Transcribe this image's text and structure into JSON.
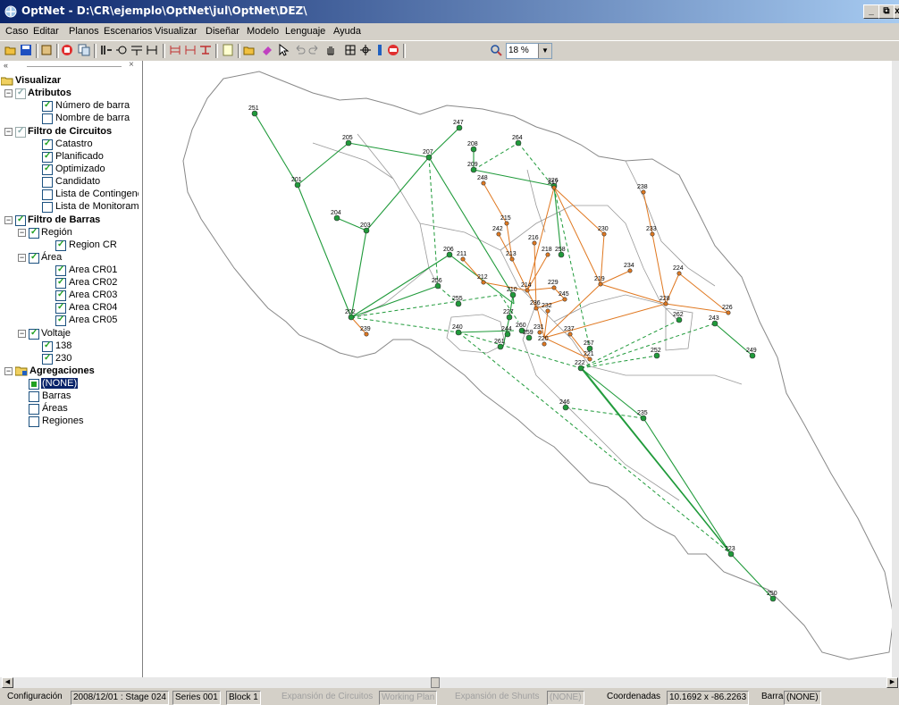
{
  "window": {
    "title": "OptNet - D:\\CR\\ejemplo\\OptNet\\jul\\OptNet\\DEZ\\"
  },
  "menu": [
    "Caso",
    "Editar",
    "Planos",
    "Escenarios",
    "Visualizar",
    "Diseñar",
    "Modelo",
    "Lenguaje",
    "Ayuda"
  ],
  "toolbar": {
    "zoom_value": "18 %"
  },
  "tree": {
    "root": "Visualizar",
    "atributos": "Atributos",
    "numero_barra": "Número de barra",
    "nombre_barra": "Nombre de barra",
    "filtro_circuitos": "Filtro de Circuitos",
    "catastro": "Catastro",
    "planificado": "Planificado",
    "optimizado": "Optimizado",
    "candidato": "Candidato",
    "lista_contingencias": "Lista de Contingenc",
    "lista_monitoreo": "Lista de Monitorami",
    "filtro_barras": "Filtro de Barras",
    "region": "Región",
    "region_cr": "Region CR",
    "area": "Área",
    "areas": [
      "Area CR01",
      "Area CR02",
      "Area CR03",
      "Area CR04",
      "Area CR05"
    ],
    "voltaje": "Voltaje",
    "v138": "138",
    "v230": "230",
    "agregaciones": "Agregaciones",
    "none": "(NONE)",
    "barras": "Barras",
    "areas_agg": "Áreas",
    "regiones": "Regiones"
  },
  "status": {
    "configuracion": "Configuración",
    "fecha_stage": "2008/12/01 : Stage 024",
    "series": "Series 001",
    "block": "Block 1",
    "exp_circuitos": "Expansión de Circuitos",
    "working_plan": "Working Plan",
    "exp_shunts": "Expansión de Shunts",
    "shunts_val": "(NONE)",
    "coordenadas_lbl": "Coordenadas",
    "coordenadas_val": "10.1692 x -86.2263",
    "barra_lbl": "Barra",
    "barra_val": "(NONE)"
  },
  "map": {
    "colors": {
      "green": "#1f9a3a",
      "orange": "#e07820",
      "border": "#808080"
    },
    "buses": [
      {
        "id": "251",
        "c": "g"
      },
      {
        "id": "205",
        "c": "g"
      },
      {
        "id": "207",
        "c": "g"
      },
      {
        "id": "247",
        "c": "g"
      },
      {
        "id": "208",
        "c": "g"
      },
      {
        "id": "264",
        "c": "g"
      },
      {
        "id": "209",
        "c": "g"
      },
      {
        "id": "201",
        "c": "g"
      },
      {
        "id": "248",
        "c": "o"
      },
      {
        "id": "226",
        "c": "g"
      },
      {
        "id": "217",
        "c": "o"
      },
      {
        "id": "238",
        "c": "o"
      },
      {
        "id": "204",
        "c": "g"
      },
      {
        "id": "203",
        "c": "g"
      },
      {
        "id": "215",
        "c": "o"
      },
      {
        "id": "242",
        "c": "o"
      },
      {
        "id": "230",
        "c": "o"
      },
      {
        "id": "233",
        "c": "o"
      },
      {
        "id": "216",
        "c": "o"
      },
      {
        "id": "206",
        "c": "g"
      },
      {
        "id": "211",
        "c": "o"
      },
      {
        "id": "213",
        "c": "o"
      },
      {
        "id": "218",
        "c": "o"
      },
      {
        "id": "258",
        "c": "g"
      },
      {
        "id": "234",
        "c": "o"
      },
      {
        "id": "224",
        "c": "o"
      },
      {
        "id": "212",
        "c": "o"
      },
      {
        "id": "256",
        "c": "g"
      },
      {
        "id": "210",
        "c": "g"
      },
      {
        "id": "214",
        "c": "o"
      },
      {
        "id": "229",
        "c": "o"
      },
      {
        "id": "219",
        "c": "o"
      },
      {
        "id": "245",
        "c": "o"
      },
      {
        "id": "255",
        "c": "g"
      },
      {
        "id": "228",
        "c": "o"
      },
      {
        "id": "226b",
        "c": "o"
      },
      {
        "id": "227",
        "c": "g"
      },
      {
        "id": "236",
        "c": "o"
      },
      {
        "id": "232",
        "c": "o"
      },
      {
        "id": "262",
        "c": "g"
      },
      {
        "id": "202",
        "c": "g"
      },
      {
        "id": "239",
        "c": "o"
      },
      {
        "id": "240",
        "c": "g"
      },
      {
        "id": "244",
        "c": "g"
      },
      {
        "id": "260",
        "c": "g"
      },
      {
        "id": "259",
        "c": "g"
      },
      {
        "id": "231",
        "c": "o"
      },
      {
        "id": "237",
        "c": "o"
      },
      {
        "id": "257",
        "c": "g"
      },
      {
        "id": "243",
        "c": "g"
      },
      {
        "id": "261",
        "c": "g"
      },
      {
        "id": "220",
        "c": "o"
      },
      {
        "id": "221",
        "c": "o"
      },
      {
        "id": "252",
        "c": "g"
      },
      {
        "id": "249",
        "c": "g"
      },
      {
        "id": "222",
        "c": "g"
      },
      {
        "id": "246",
        "c": "g"
      },
      {
        "id": "235",
        "c": "g"
      },
      {
        "id": "223",
        "c": "g"
      },
      {
        "id": "250",
        "c": "g"
      }
    ]
  }
}
